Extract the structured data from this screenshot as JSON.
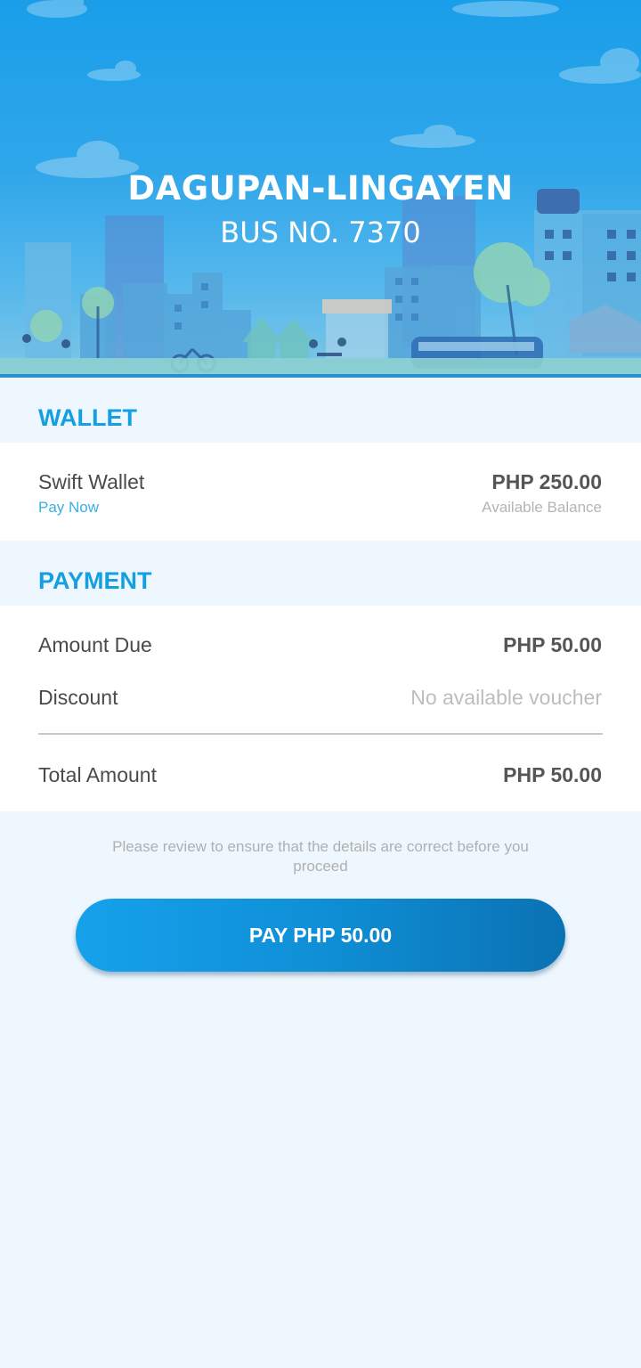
{
  "header": {
    "route": "DAGUPAN-LINGAYEN",
    "bus_number": "BUS NO. 7370"
  },
  "wallet": {
    "section_title": "WALLET",
    "name": "Swift Wallet",
    "action": "Pay Now",
    "balance": "PHP 250.00",
    "balance_caption": "Available Balance"
  },
  "payment": {
    "section_title": "PAYMENT",
    "amount_due_label": "Amount Due",
    "amount_due_value": "PHP 50.00",
    "discount_label": "Discount",
    "discount_value": "No available voucher",
    "total_label": "Total Amount",
    "total_value": "PHP 50.00"
  },
  "notice": "Please review to ensure that the details are correct before you proceed",
  "pay_button_label": "PAY PHP 50.00",
  "colors": {
    "accent": "#139fe2",
    "button_gradient_start": "#16a1ec",
    "button_gradient_end": "#0a72b3",
    "background": "#eef7fd"
  }
}
